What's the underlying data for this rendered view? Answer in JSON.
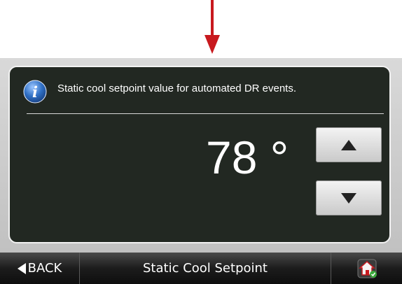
{
  "info": {
    "icon": "info-icon",
    "message": "Static cool setpoint value for automated DR events."
  },
  "setpoint": {
    "value": "78 °"
  },
  "controls": {
    "increase_icon": "triangle-up-icon",
    "decrease_icon": "triangle-down-icon"
  },
  "navbar": {
    "back_label": "BACK",
    "title": "Static Cool Setpoint",
    "home_icon": "home-icon"
  },
  "colors": {
    "panel_background": "#222822",
    "pointer_arrow": "#c8191e",
    "info_icon": "#2f6fc4"
  }
}
